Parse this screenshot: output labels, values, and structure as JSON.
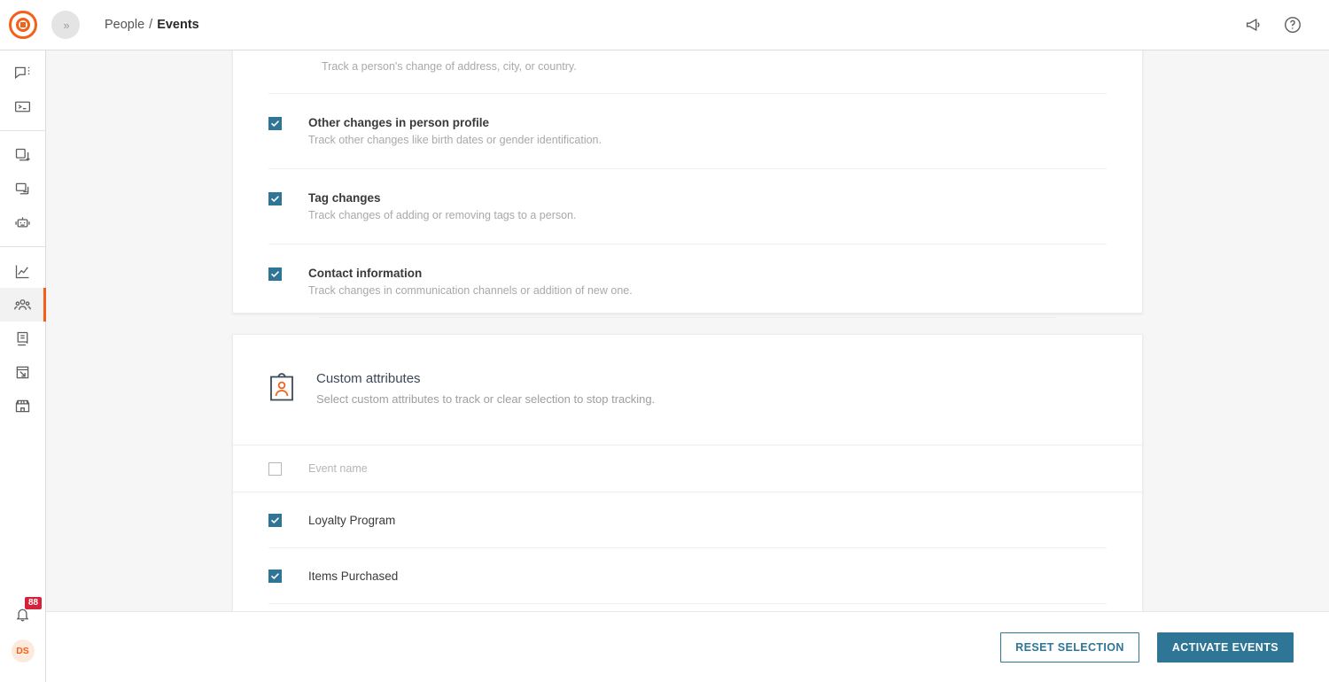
{
  "header": {
    "logo_name": "bloomreach-logo",
    "collapse_label": "»",
    "breadcrumb": {
      "parent": "People",
      "separator": "/",
      "current": "Events"
    },
    "icons": [
      {
        "name": "megaphone-icon"
      },
      {
        "name": "help-circle-icon"
      }
    ]
  },
  "sidebar": {
    "groups": [
      {
        "items": [
          {
            "name": "campaigns-icon",
            "label": "Campaigns",
            "active": false
          },
          {
            "name": "console-icon",
            "label": "Console",
            "active": false
          }
        ]
      },
      {
        "items": [
          {
            "name": "copy-stack-icon",
            "label": "Assets",
            "active": false
          },
          {
            "name": "archive-icon",
            "label": "Archive",
            "active": false
          },
          {
            "name": "robot-icon",
            "label": "Automations",
            "active": false
          }
        ]
      },
      {
        "items": [
          {
            "name": "analytics-chart-icon",
            "label": "Analytics",
            "active": false
          },
          {
            "name": "people-icon",
            "label": "People",
            "active": true
          },
          {
            "name": "data-manager-icon",
            "label": "Data manager",
            "active": false
          },
          {
            "name": "web-layers-icon",
            "label": "Web layers",
            "active": false
          },
          {
            "name": "storefront-icon",
            "label": "Storefront",
            "active": false
          }
        ]
      }
    ],
    "notifications": {
      "name": "notifications-bell",
      "badge_count": "88"
    },
    "user": {
      "initials": "DS"
    }
  },
  "tracking_card": {
    "clipped_row": {
      "desc": "Track a person's change of address, city, or country."
    },
    "options": [
      {
        "title": "Other changes in person profile",
        "desc": "Track other changes like birth dates or gender identification.",
        "checked": true
      },
      {
        "title": "Tag changes",
        "desc": "Track changes of adding or removing tags to a person.",
        "checked": true
      },
      {
        "title": "Contact information",
        "desc": "Track changes in communication channels or addition of new one.",
        "checked": true
      }
    ]
  },
  "custom_attributes": {
    "icon_name": "id-badge-icon",
    "title": "Custom attributes",
    "subtitle": "Select custom attributes to track or clear selection to stop tracking.",
    "table": {
      "header": {
        "select_all_checked": false,
        "column_label": "Event name"
      },
      "rows": [
        {
          "label": "Loyalty Program",
          "checked": true
        },
        {
          "label": "Items Purchased",
          "checked": true
        }
      ]
    }
  },
  "footer": {
    "reset_label": "RESET SELECTION",
    "activate_label": "ACTIVATE EVENTS"
  },
  "colors": {
    "brand_orange": "#f4601a",
    "accent_teal": "#2e7596",
    "badge_red": "#d6213a",
    "page_bg": "#f6f6f6"
  }
}
